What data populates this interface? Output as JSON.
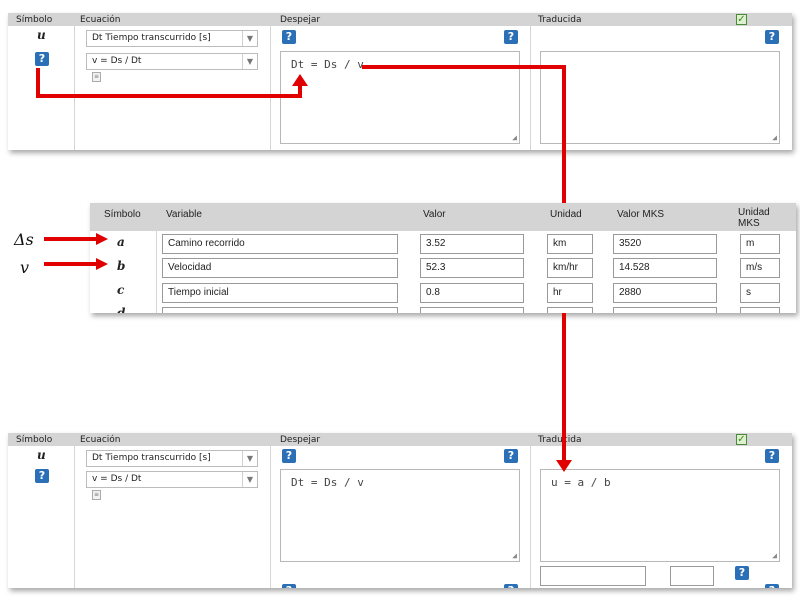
{
  "top_panel": {
    "headers": {
      "simbolo": "Símbolo",
      "ecuacion": "Ecuación",
      "despejar": "Despejar",
      "traducida": "Traducida"
    },
    "symbol": "u",
    "variable_select": "Dt Tiempo transcurrido [s]",
    "equation_select": "v = Ds / Dt",
    "despejar_text": "Dt = Ds / v",
    "traducida_text": "",
    "help_glyph": "?"
  },
  "var_table": {
    "headers": {
      "simbolo": "Símbolo",
      "variable": "Variable",
      "valor": "Valor",
      "unidad": "Unidad",
      "valor_mks": "Valor MKS",
      "unidad_mks": "Unidad MKS"
    },
    "rows": [
      {
        "symbol": "a",
        "variable": "Camino recorrido",
        "valor": "3.52",
        "unidad": "km",
        "valor_mks": "3520",
        "unidad_mks": "m"
      },
      {
        "symbol": "b",
        "variable": "Velocidad",
        "valor": "52.3",
        "unidad": "km/hr",
        "valor_mks": "14.528",
        "unidad_mks": "m/s"
      },
      {
        "symbol": "c",
        "variable": "Tiempo inicial",
        "valor": "0.8",
        "unidad": "hr",
        "valor_mks": "2880",
        "unidad_mks": "s"
      }
    ],
    "partial_symbol": "d"
  },
  "annotations": {
    "delta_s": "Δs",
    "v": "v"
  },
  "bottom_panel": {
    "headers": {
      "simbolo": "Símbolo",
      "ecuacion": "Ecuación",
      "despejar": "Despejar",
      "traducida": "Traducida"
    },
    "symbol": "u",
    "variable_select": "Dt Tiempo transcurrido [s]",
    "equation_select": "v = Ds / Dt",
    "despejar_text": "Dt = Ds / v",
    "traducida_text": "u = a / b",
    "help_glyph": "?"
  },
  "colors": {
    "arrow": "#e00000",
    "help_button": "#2b6fb7",
    "header_bg": "#d4d4d4"
  }
}
